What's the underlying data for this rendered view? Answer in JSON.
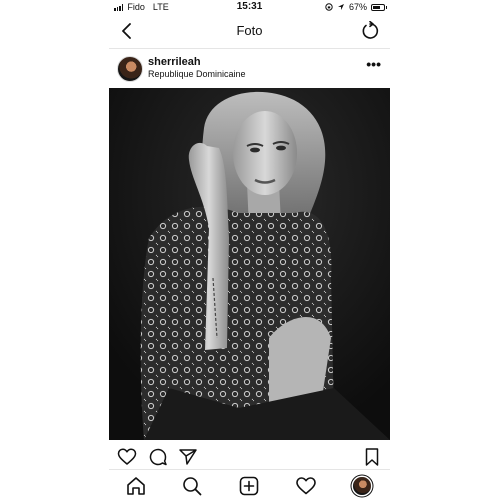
{
  "status_bar": {
    "carrier": "Fido",
    "network": "LTE",
    "time": "15:31",
    "battery_percent_label": "67%",
    "battery_level": 0.67
  },
  "nav": {
    "title": "Foto",
    "back_icon": "chevron-left-icon",
    "refresh_icon": "refresh-icon"
  },
  "post": {
    "username": "sherrileah",
    "location": "Republique Dominicaine",
    "more_label": "•••",
    "photo_description": "black-and-white portrait photo"
  },
  "actions": {
    "like_icon": "heart-icon",
    "comment_icon": "comment-icon",
    "share_icon": "send-icon",
    "save_icon": "bookmark-icon"
  },
  "tabbar": {
    "items": [
      "home-icon",
      "search-icon",
      "add-post-icon",
      "activity-heart-icon",
      "profile-avatar"
    ]
  },
  "colors": {
    "background": "#ffffff",
    "text": "#111111",
    "divider": "#e5e5e5"
  }
}
